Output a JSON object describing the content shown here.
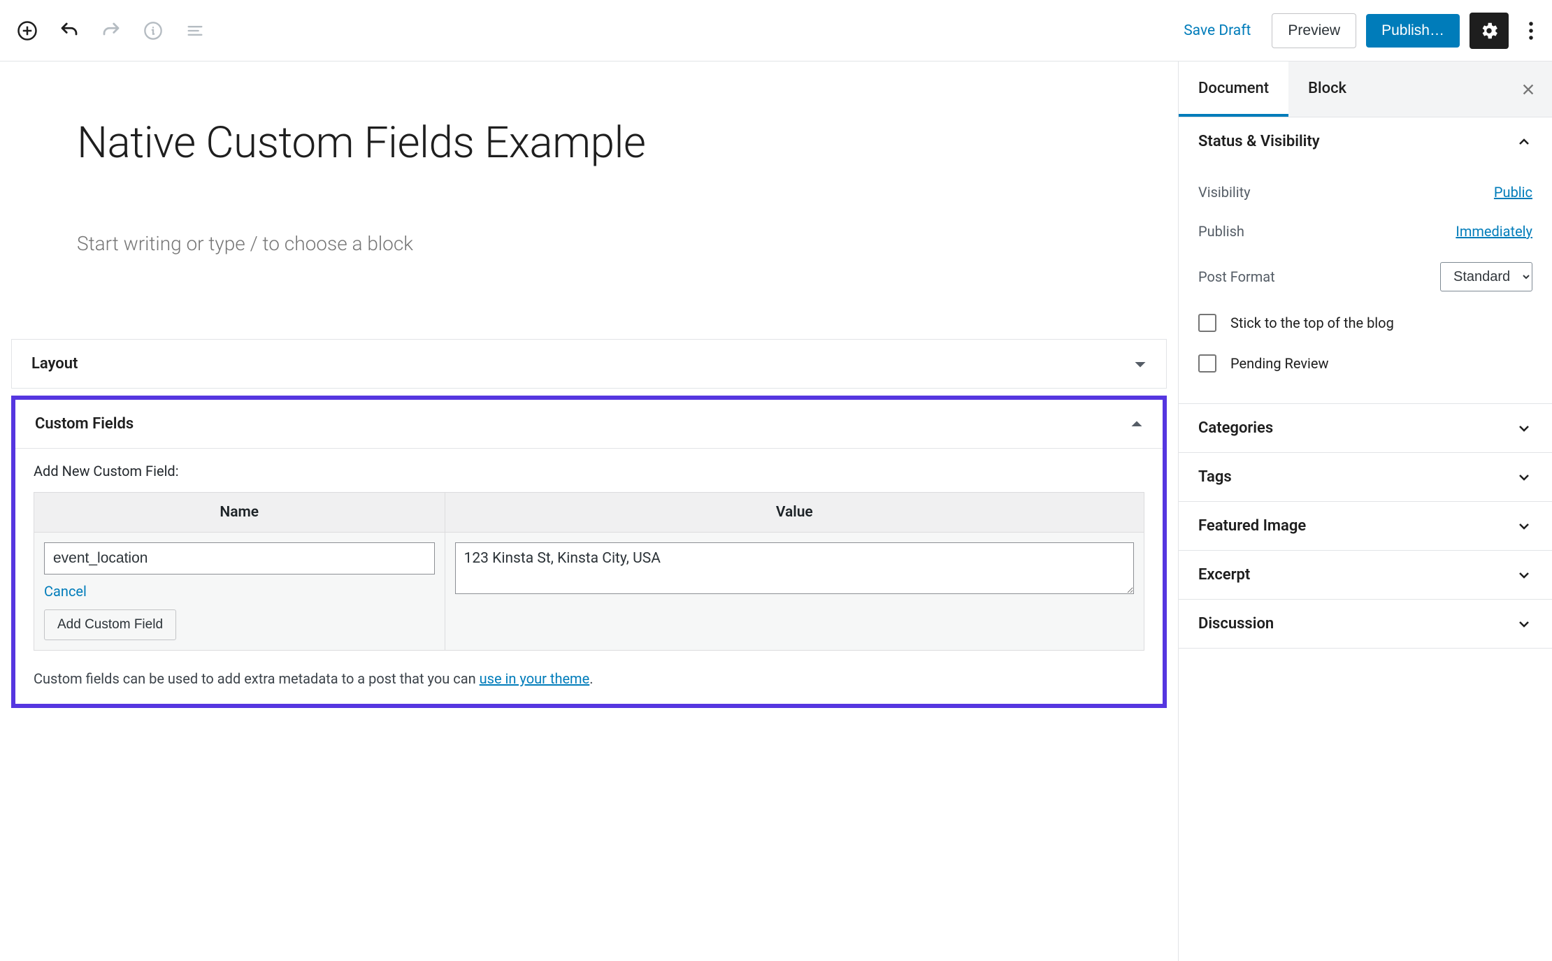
{
  "toolbar": {
    "save_draft": "Save Draft",
    "preview": "Preview",
    "publish": "Publish…"
  },
  "post": {
    "title": "Native Custom Fields Example",
    "body_placeholder": "Start writing or type / to choose a block"
  },
  "metaboxes": {
    "layout_title": "Layout",
    "custom_fields": {
      "title": "Custom Fields",
      "add_new_label": "Add New Custom Field:",
      "name_header": "Name",
      "value_header": "Value",
      "name_value": "event_location",
      "field_value": "123 Kinsta St, Kinsta City, USA",
      "cancel": "Cancel",
      "add_btn": "Add Custom Field",
      "note_pre": "Custom fields can be used to add extra metadata to a post that you can ",
      "note_link": "use in your theme",
      "note_post": "."
    }
  },
  "sidebar": {
    "tabs": {
      "document": "Document",
      "block": "Block"
    },
    "status": {
      "title": "Status & Visibility",
      "visibility_label": "Visibility",
      "visibility_value": "Public",
      "publish_label": "Publish",
      "publish_value": "Immediately",
      "format_label": "Post Format",
      "format_value": "Standard",
      "stick_label": "Stick to the top of the blog",
      "pending_label": "Pending Review"
    },
    "panels": {
      "categories": "Categories",
      "tags": "Tags",
      "featured": "Featured Image",
      "excerpt": "Excerpt",
      "discussion": "Discussion"
    }
  }
}
